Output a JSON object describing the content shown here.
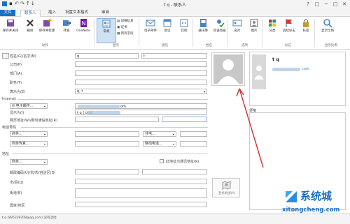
{
  "window": {
    "title": "t q - 联系人",
    "help": "?",
    "restore": "□",
    "minimize": "─",
    "maximize": "□",
    "close": "✕"
  },
  "tabs": [
    "文件",
    "联系人",
    "插入",
    "设置文本格式",
    "审阅"
  ],
  "ribbon": {
    "buttons": {
      "save_close": "保存并关闭",
      "delete": "删除",
      "save_new": "保存并新建",
      "forward": "转发",
      "onenote": "OneNote",
      "general": "常规",
      "details": "详细信息",
      "certificate": "证书",
      "all_fields": "所有字段",
      "email": "电子邮件",
      "meeting": "会议",
      "more": "其他",
      "address_book": "通讯簿",
      "check_names": "检查姓名",
      "business_card": "名片",
      "picture": "图片",
      "categorize": "分类",
      "follow_up": "后续标志",
      "private": "私密",
      "zoom": "显示比例"
    },
    "groups": {
      "actions": "动作",
      "show": "显示",
      "communicate": "通信",
      "names": "姓名",
      "options": "选项",
      "tags": "标记",
      "zoom": "显示比例"
    }
  },
  "form": {
    "full_name_btn": "姓名(G)",
    "name_sep": "/名字(M)",
    "last_name": "q",
    "first_name": "t",
    "company": "公司(P)",
    "department": "部门(A)",
    "job_title": "职务(T)",
    "file_as": "表示为(E)",
    "file_as_value": "q, t",
    "internet_section": "Internet",
    "email_btn": "电子邮件...",
    "email_value": "om",
    "display_as": "显示为(I)",
    "display_value": "t q (                          om)",
    "web": "网页地址(W)",
    "im": "/即时通信地址(R)",
    "phone_section": "电话号码",
    "phone_business": "商务...",
    "phone_home": "住宅...",
    "phone_bizfax": "商务传真...",
    "phone_mobile": "移动电话...",
    "address_section": "地址",
    "address_business": "商务...",
    "mailing_address": "此地址为通讯地址(R)",
    "postal": "邮政编码(U)",
    "province": "/省/市/自治区(D)",
    "city": "市/县(Q)",
    "street": "街道(B)",
    "country": "国家/地区",
    "map_btn": "查找地图(A)",
    "notes_label": "便笺"
  },
  "card": {
    "name": "t q",
    "email_suffix": "com"
  },
  "statusbar": {
    "text": "t q (885339208@qq.com) 没有活动"
  },
  "watermark": {
    "brand": "系统城",
    "url": "xitongcheng.com"
  }
}
